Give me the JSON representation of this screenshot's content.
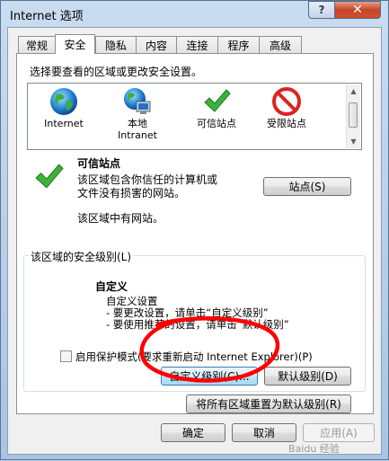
{
  "window": {
    "title": "Internet 选项",
    "help_label": "?",
    "close_label": "✕"
  },
  "tabs": [
    {
      "label": "常规",
      "active": false
    },
    {
      "label": "安全",
      "active": true
    },
    {
      "label": "隐私",
      "active": false
    },
    {
      "label": "内容",
      "active": false
    },
    {
      "label": "连接",
      "active": false
    },
    {
      "label": "程序",
      "active": false
    },
    {
      "label": "高级",
      "active": false
    }
  ],
  "security": {
    "prompt": "选择要查看的区域或更改安全设置。",
    "zones": [
      {
        "line1": "Internet",
        "line2": "",
        "icon": "globe-icon"
      },
      {
        "line1": "本地",
        "line2": "Intranet",
        "icon": "intranet-globe-icon"
      },
      {
        "line1": "可信站点",
        "line2": "",
        "icon": "checkmark-icon"
      },
      {
        "line1": "受限站点",
        "line2": "",
        "icon": "no-entry-icon"
      }
    ],
    "selected_zone": {
      "title": "可信站点",
      "desc_line1": "该区域包含你信任的计算机或",
      "desc_line2": "文件没有损害的网站。",
      "has_sites": "该区域中有网站。",
      "sites_button": "站点(S)"
    },
    "level_group": {
      "label": "该区域的安全级别(L)",
      "level_name": "自定义",
      "lines": [
        "自定义设置",
        "- 要更改设置，请单击“自定义级别”",
        "- 要使用推荐的设置，请单击“默认级别”"
      ],
      "protected_mode": "启用保护模式(要求重新启动 Internet Explorer)(P)",
      "custom_level_button": "自定义级别(C)...",
      "default_level_button": "默认级别(D)"
    },
    "reset_all_button": "将所有区域重置为默认级别(R)"
  },
  "footer": {
    "ok": "确定",
    "cancel": "取消",
    "apply": "应用(A)"
  },
  "watermark": "Baidu 经验",
  "colors": {
    "annotation_red": "#ff0000",
    "focus_blue": "#3c7fb1"
  }
}
